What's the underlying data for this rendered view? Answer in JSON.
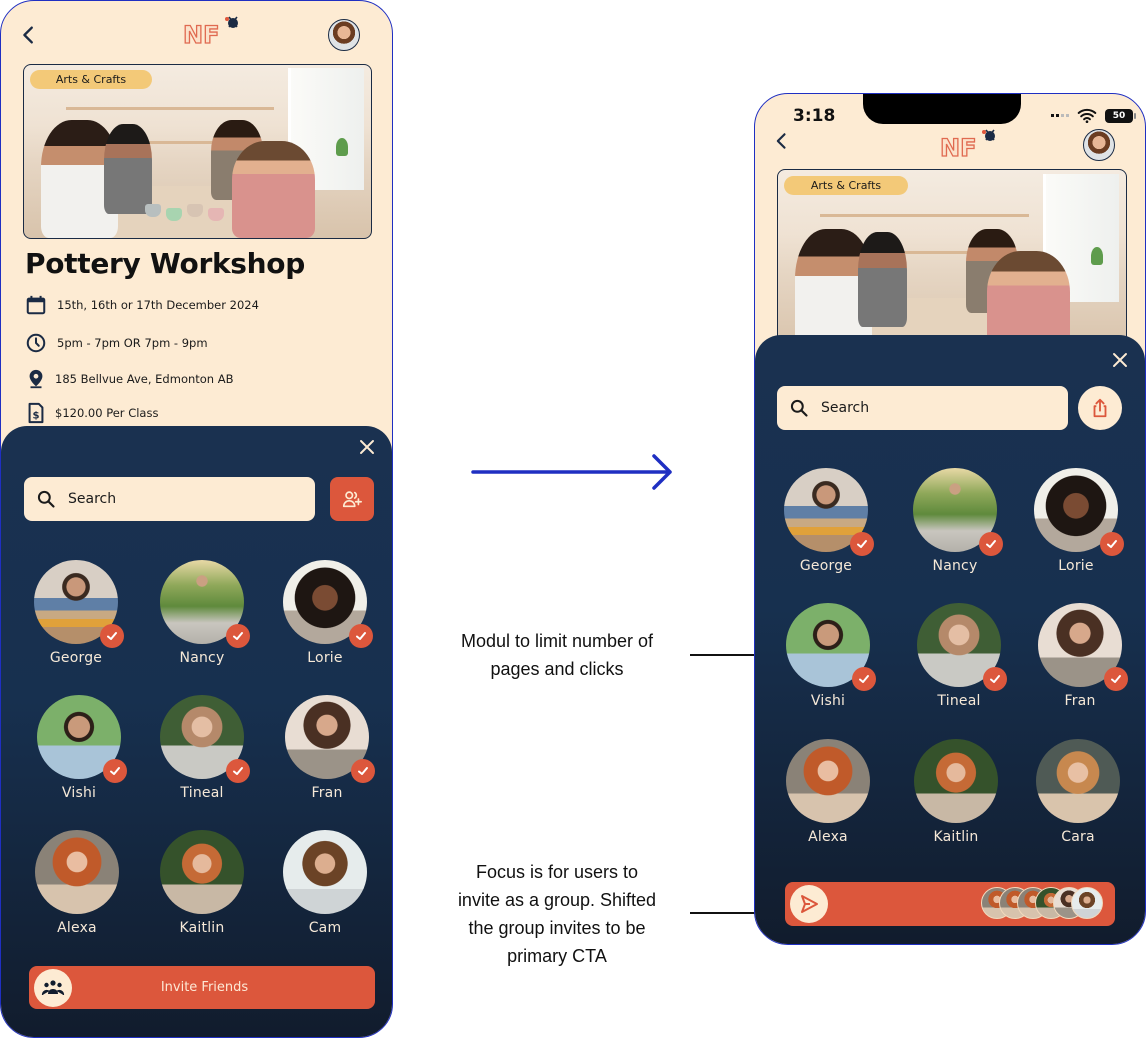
{
  "colors": {
    "cream": "#fdebd3",
    "navy": "#1a3150",
    "accent": "#dc573c",
    "tag": "#f3c978",
    "frame": "#1f2fc2",
    "arrow": "#1f2fc2"
  },
  "before": {
    "header": {
      "back_icon": "chevron-left-icon",
      "logo_text": "NF",
      "profile_avatar": "user-avatar"
    },
    "event": {
      "category": "Arts & Crafts",
      "title": "Pottery Workshop",
      "details": [
        {
          "icon": "calendar-icon",
          "text": "15th, 16th or 17th December 2024"
        },
        {
          "icon": "clock-icon",
          "text": "5pm - 7pm OR 7pm - 9pm"
        },
        {
          "icon": "location-pin-icon",
          "text": "185 Bellvue Ave, Edmonton AB"
        },
        {
          "icon": "invoice-dollar-icon",
          "text": "$120.00 Per Class"
        }
      ]
    },
    "sheet": {
      "search_placeholder": "Search",
      "side_button_icon": "add-user-icon",
      "friends": [
        {
          "name": "George",
          "selected": true
        },
        {
          "name": "Nancy",
          "selected": true
        },
        {
          "name": "Lorie",
          "selected": true
        },
        {
          "name": "Vishi",
          "selected": true
        },
        {
          "name": "Tineal",
          "selected": true
        },
        {
          "name": "Fran",
          "selected": true
        },
        {
          "name": "Alexa",
          "selected": false
        },
        {
          "name": "Kaitlin",
          "selected": false
        },
        {
          "name": "Cam",
          "selected": false
        }
      ],
      "cta_label": "Invite Friends",
      "cta_icon": "group-icon"
    }
  },
  "after": {
    "status_bar": {
      "time": "3:18",
      "battery": "50"
    },
    "header": {
      "back_icon": "chevron-left-icon",
      "logo_text": "NF",
      "profile_avatar": "user-avatar"
    },
    "event": {
      "category": "Arts & Crafts"
    },
    "sheet": {
      "search_placeholder": "Search",
      "side_button_icon": "share-icon",
      "friends": [
        {
          "name": "George",
          "selected": true
        },
        {
          "name": "Nancy",
          "selected": true
        },
        {
          "name": "Lorie",
          "selected": true
        },
        {
          "name": "Vishi",
          "selected": true
        },
        {
          "name": "Tineal",
          "selected": true
        },
        {
          "name": "Fran",
          "selected": true
        },
        {
          "name": "Alexa",
          "selected": false
        },
        {
          "name": "Kaitlin",
          "selected": false
        },
        {
          "name": "Cara",
          "selected": false
        }
      ],
      "cta_icon": "send-icon",
      "selected_stack_count": 6
    }
  },
  "annotations": {
    "module": "Modul to limit number of pages and clicks",
    "module_lines": [
      "Modul to limit number of",
      "pages and clicks"
    ],
    "focus": "Focus is for users to invite as a group. Shifted the group invites to be primary CTA",
    "focus_lines": [
      "Focus is for users to",
      "invite as a group. Shifted",
      "the group invites to be",
      "primary CTA"
    ]
  }
}
